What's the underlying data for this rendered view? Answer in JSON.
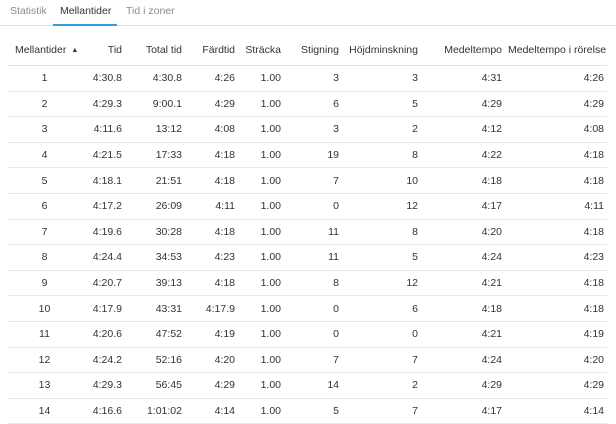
{
  "tabs": [
    {
      "label": "Statistik",
      "active": false
    },
    {
      "label": "Mellantider",
      "active": true
    },
    {
      "label": "Tid i zoner",
      "active": false
    }
  ],
  "accent_color": "#29a3e0",
  "table": {
    "headers": [
      "Mellantider",
      "Tid",
      "Total tid",
      "Färdtid",
      "Sträcka",
      "Stigning",
      "Höjdminskning",
      "Medeltempo",
      "Medeltempo i rörelse"
    ],
    "sort_indicator": "▲",
    "rows": [
      [
        "1",
        "4:30.8",
        "4:30.8",
        "4:26",
        "1.00",
        "3",
        "3",
        "4:31",
        "4:26"
      ],
      [
        "2",
        "4:29.3",
        "9:00.1",
        "4:29",
        "1.00",
        "6",
        "5",
        "4:29",
        "4:29"
      ],
      [
        "3",
        "4:11.6",
        "13:12",
        "4:08",
        "1.00",
        "3",
        "2",
        "4:12",
        "4:08"
      ],
      [
        "4",
        "4:21.5",
        "17:33",
        "4:18",
        "1.00",
        "19",
        "8",
        "4:22",
        "4:18"
      ],
      [
        "5",
        "4:18.1",
        "21:51",
        "4:18",
        "1.00",
        "7",
        "10",
        "4:18",
        "4:18"
      ],
      [
        "6",
        "4:17.2",
        "26:09",
        "4:11",
        "1.00",
        "0",
        "12",
        "4:17",
        "4:11"
      ],
      [
        "7",
        "4:19.6",
        "30:28",
        "4:18",
        "1.00",
        "11",
        "8",
        "4:20",
        "4:18"
      ],
      [
        "8",
        "4:24.4",
        "34:53",
        "4:23",
        "1.00",
        "11",
        "5",
        "4:24",
        "4:23"
      ],
      [
        "9",
        "4:20.7",
        "39:13",
        "4:18",
        "1.00",
        "8",
        "12",
        "4:21",
        "4:18"
      ],
      [
        "10",
        "4:17.9",
        "43:31",
        "4:17.9",
        "1.00",
        "0",
        "6",
        "4:18",
        "4:18"
      ],
      [
        "11",
        "4:20.6",
        "47:52",
        "4:19",
        "1.00",
        "0",
        "0",
        "4:21",
        "4:19"
      ],
      [
        "12",
        "4:24.2",
        "52:16",
        "4:20",
        "1.00",
        "7",
        "7",
        "4:24",
        "4:20"
      ],
      [
        "13",
        "4:29.3",
        "56:45",
        "4:29",
        "1.00",
        "14",
        "2",
        "4:29",
        "4:29"
      ],
      [
        "14",
        "4:16.6",
        "1:01:02",
        "4:14",
        "1.00",
        "5",
        "7",
        "4:17",
        "4:14"
      ]
    ]
  }
}
